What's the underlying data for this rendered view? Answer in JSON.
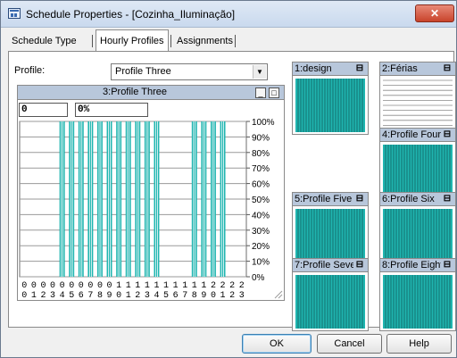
{
  "window": {
    "title": "Schedule Properties - [Cozinha_Iluminação]",
    "close_glyph": "✕"
  },
  "tabs": [
    {
      "label": "Schedule Type",
      "active": false
    },
    {
      "label": "Hourly Profiles",
      "active": true
    },
    {
      "label": "Assignments",
      "active": false
    }
  ],
  "profile": {
    "label": "Profile:",
    "selected": "Profile Three"
  },
  "editor": {
    "title": "3:Profile Three",
    "minimize_glyph": "_",
    "maximize_glyph": "□",
    "hour_value": "0",
    "level_value": "0%"
  },
  "chart_data": {
    "type": "bar",
    "title": "3:Profile Three",
    "categories": [
      "00",
      "01",
      "02",
      "03",
      "04",
      "05",
      "06",
      "07",
      "08",
      "09",
      "10",
      "11",
      "12",
      "13",
      "14",
      "15",
      "16",
      "17",
      "18",
      "19",
      "20",
      "21",
      "22",
      "23"
    ],
    "values": [
      0,
      0,
      0,
      0,
      100,
      100,
      100,
      100,
      100,
      100,
      100,
      100,
      100,
      100,
      100,
      0,
      0,
      0,
      100,
      100,
      100,
      100,
      0,
      0
    ],
    "y_ticks": [
      "100%",
      "90%",
      "80%",
      "70%",
      "60%",
      "50%",
      "40%",
      "30%",
      "20%",
      "10%",
      "0%"
    ],
    "ylim": [
      0,
      100
    ],
    "grid": true,
    "bar_color": "#1fb5b0"
  },
  "thumbnails": [
    {
      "title": "1:design",
      "ctl": "⊟",
      "pattern": "full"
    },
    {
      "title": "2:Férias",
      "ctl": "⊟",
      "pattern": "empty"
    },
    {
      "title": "4:Profile Four",
      "ctl": "⊟",
      "pattern": "full"
    },
    {
      "title": "5:Profile Five",
      "ctl": "⊟",
      "pattern": "full"
    },
    {
      "title": "6:Profile Six",
      "ctl": "⊟",
      "pattern": "full"
    },
    {
      "title": "7:Profile Seven",
      "ctl": "⊟",
      "pattern": "full"
    },
    {
      "title": "8:Profile Eight",
      "ctl": "⊟",
      "pattern": "full"
    }
  ],
  "buttons": {
    "ok": "OK",
    "cancel": "Cancel",
    "help": "Help"
  },
  "colors": {
    "bar": "#1fb5b0",
    "thumb_bar": "#1fb5b0",
    "title_bar": "#c9d9ee",
    "panel_header": "#b8c7db"
  }
}
